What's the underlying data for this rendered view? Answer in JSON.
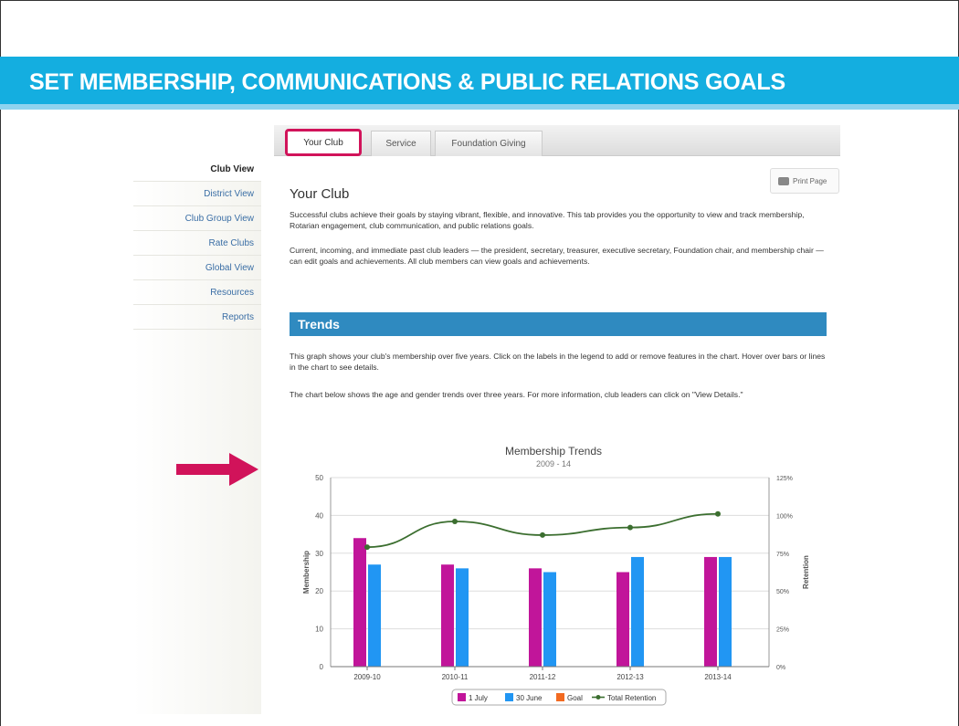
{
  "slide": {
    "title": "SET MEMBERSHIP, COMMUNICATIONS & PUBLIC RELATIONS GOALS"
  },
  "tabs": [
    {
      "label": "Your Club",
      "active": true
    },
    {
      "label": "Service",
      "active": false
    },
    {
      "label": "Foundation Giving",
      "active": false
    }
  ],
  "sidebar": {
    "items": [
      {
        "label": "Club View",
        "active": true
      },
      {
        "label": "District View",
        "active": false
      },
      {
        "label": "Club Group View",
        "active": false
      },
      {
        "label": "Rate Clubs",
        "active": false
      },
      {
        "label": "Global View",
        "active": false
      },
      {
        "label": "Resources",
        "active": false
      },
      {
        "label": "Reports",
        "active": false
      }
    ]
  },
  "print_button": {
    "label": "Print Page",
    "icon": "printer-icon"
  },
  "main": {
    "title": "Your Club",
    "intro_1": "Successful clubs achieve their goals by staying vibrant, flexible, and innovative. This tab provides you the opportunity to view and track membership, Rotarian engagement, club communication, and public relations goals.",
    "intro_2": "Current, incoming, and immediate past club leaders — the president, secretary, treasurer, executive secretary, Foundation chair, and membership chair — can edit goals and achievements. All club members can view goals and achievements.",
    "trends_heading": "Trends",
    "trends_1": "This graph shows your club's membership over five years. Click on the labels in the legend to add or remove features in the chart. Hover over bars or lines in the chart to see details.",
    "trends_2": "The chart below shows the age and gender trends over three years. For more information, club leaders can click on \"View Details.\""
  },
  "colors": {
    "banner": "#14aee0",
    "accent_highlight": "#d1135a",
    "section_bar": "#2f8ac0",
    "series_1july": "#c1159a",
    "series_30june": "#2196f3",
    "series_goal": "#f26a21",
    "series_retention": "#3b6e2f"
  },
  "chart_data": {
    "type": "bar",
    "title": "Membership Trends",
    "subtitle": "2009 - 14",
    "categories": [
      "2009-10",
      "2010-11",
      "2011-12",
      "2012-13",
      "2013-14"
    ],
    "ylabel": "Membership",
    "ylabel_right": "Retention",
    "ylim": [
      0,
      50
    ],
    "yticks": [
      "0",
      "10",
      "20",
      "30",
      "40",
      "50"
    ],
    "ylim_right": [
      0,
      125
    ],
    "yticks_right": [
      "0%",
      "25%",
      "50%",
      "75%",
      "100%",
      "125%"
    ],
    "series": [
      {
        "name": "1 July",
        "type": "bar",
        "values": [
          34,
          27,
          26,
          25,
          29
        ]
      },
      {
        "name": "30 June",
        "type": "bar",
        "values": [
          27,
          26,
          25,
          29,
          29
        ]
      },
      {
        "name": "Goal",
        "type": "bar",
        "values": []
      },
      {
        "name": "Total Retention",
        "type": "line",
        "axis": "right",
        "values": [
          79,
          96,
          87,
          92,
          101
        ]
      }
    ],
    "legend_position": "bottom",
    "grid": "horizontal"
  }
}
